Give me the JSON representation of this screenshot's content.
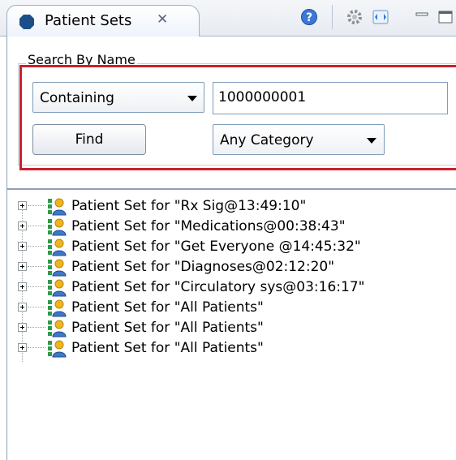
{
  "view": {
    "title": "Patient Sets",
    "close_glyph": "✕",
    "toolbar_icons": [
      "help-icon",
      "settings-icon",
      "link-icon",
      "minimize-icon",
      "maximize-icon"
    ]
  },
  "search": {
    "group_label": "Search By Name",
    "match_mode": "Containing",
    "query": "1000000001",
    "find_label": "Find",
    "category": "Any Category"
  },
  "tree": {
    "items": [
      "Patient Set for \"Rx Sig@13:49:10\"",
      "Patient Set for \"Medications@00:38:43\"",
      "Patient Set for \"Get Everyone @14:45:32\"",
      "Patient Set for \"Diagnoses@02:12:20\"",
      "Patient Set for \"Circulatory sys@03:16:17\"",
      "Patient Set for \"All Patients\"",
      "Patient Set for \"All Patients\"",
      "Patient Set for \"All Patients\""
    ]
  },
  "colors": {
    "highlight": "#cc1f2a",
    "tab_icon": "#1b4f8a"
  }
}
